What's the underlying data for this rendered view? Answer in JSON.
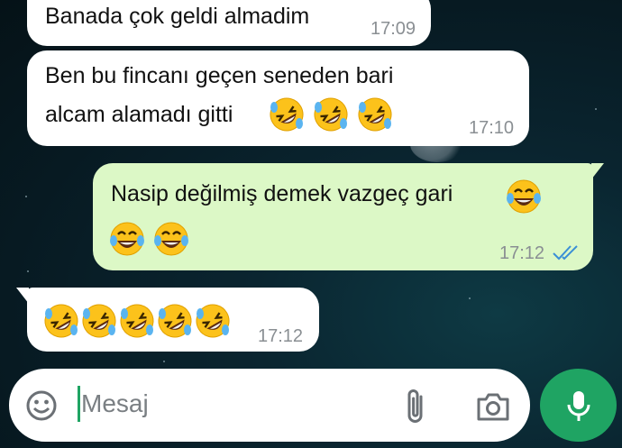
{
  "messages": [
    {
      "direction": "incoming",
      "text": "Banada çok geldi almadim",
      "time": "17:09"
    },
    {
      "direction": "incoming",
      "line1": "Ben bu fincanı geçen seneden bari",
      "line2": "alcam alamadı gitti",
      "emoji": "rolling-on-floor-laughing",
      "emoji_count": 3,
      "time": "17:10"
    },
    {
      "direction": "outgoing",
      "line1": "Nasip değilmiş demek vazgeç gari",
      "emoji": "tears-of-joy",
      "emoji_count": 3,
      "time": "17:12",
      "status": "read"
    },
    {
      "direction": "incoming",
      "emoji": "rolling-on-floor-laughing",
      "emoji_count": 5,
      "time": "17:12"
    }
  ],
  "composer": {
    "placeholder": "Mesaj"
  },
  "colors": {
    "incoming_bubble": "#ffffff",
    "outgoing_bubble": "#dcf8c6",
    "accent": "#1fa463",
    "read_ticks": "#3a8fd6"
  }
}
